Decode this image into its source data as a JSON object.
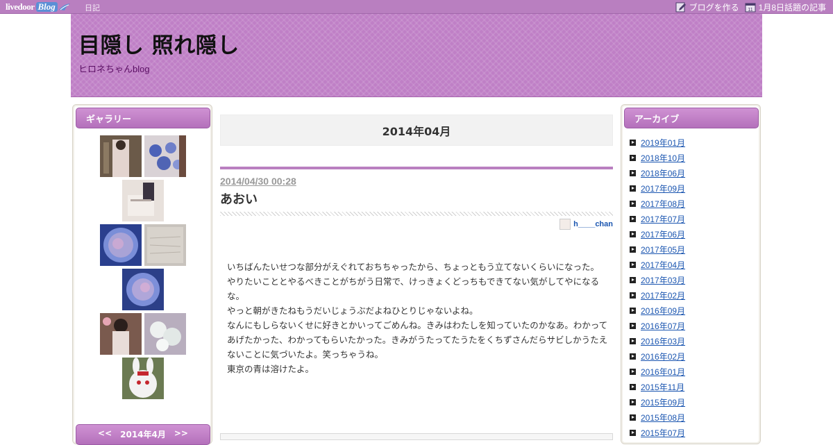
{
  "topbar": {
    "logo_text": "livedoor",
    "logo_blog": "Blog",
    "diary": "日記",
    "create_blog": "ブログを作る",
    "trending": "1月8日話題の記事"
  },
  "header": {
    "title": "目隠し 照れ隠し",
    "subtitle": "ヒロネちゃんblog"
  },
  "gallery": {
    "heading": "ギャラリー",
    "calendar_prev": "<<",
    "calendar_label": "2014年4月",
    "calendar_next": ">>"
  },
  "archive": {
    "heading": "アーカイブ",
    "items": [
      "2019年01月",
      "2018年10月",
      "2018年06月",
      "2017年09月",
      "2017年08月",
      "2017年07月",
      "2017年06月",
      "2017年05月",
      "2017年04月",
      "2017年03月",
      "2017年02月",
      "2016年09月",
      "2016年07月",
      "2016年03月",
      "2016年02月",
      "2016年01月",
      "2015年11月",
      "2015年09月",
      "2015年08月",
      "2015年07月"
    ]
  },
  "main": {
    "month_title": "2014年04月",
    "post": {
      "date": "2014/04/30 00:28",
      "title": "あおい",
      "author": "h____chan",
      "lines": [
        "いちばんたいせつな部分がえぐれておちちゃったから、ちょっともう立てないくらいになった。",
        "やりたいこととやるべきことがちがう日常で、けっきょくどっちもできてない気がしてやになるな。",
        "やっと朝がきたねもうだいじょうぶだよねひとりじゃないよね。",
        "なんにもしらないくせに好きとかいってごめんね。きみはわたしを知っていたのかなあ。わかってあげたかった、わかってもらいたかった。きみがうたってたうたをくちずさんだらサビしかうたえないことに気づいたよ。笑っちゃうね。",
        "東京の青は溶けたよ。"
      ]
    }
  },
  "colors": {
    "accent": "#b97fc0",
    "link": "#1a55b0"
  }
}
